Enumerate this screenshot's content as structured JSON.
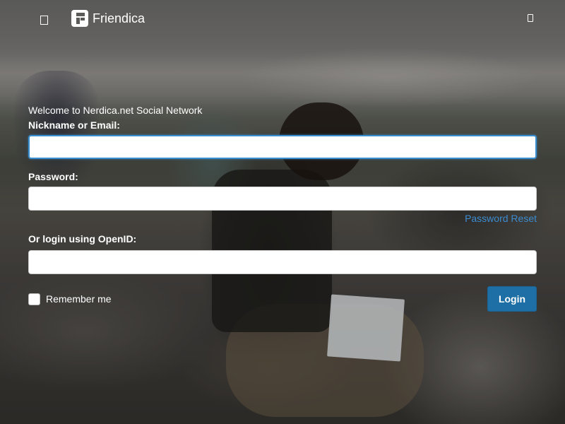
{
  "app": {
    "name": "Friendica"
  },
  "icons": {
    "menu": "menu-toggle-icon",
    "logo": "friendica-logo-icon",
    "account": "login-toggle-icon"
  },
  "colors": {
    "link": "#3b8bd0",
    "button": "#1d6fa5",
    "focus_border": "#3a8fd0"
  },
  "login": {
    "welcome": "Welcome to Nerdica.net Social Network",
    "nickname_label": "Nickname or Email:",
    "nickname_value": "",
    "password_label": "Password:",
    "password_value": "",
    "password_reset": "Password Reset",
    "openid_label": "Or login using OpenID:",
    "openid_value": "",
    "remember_me": "Remember me",
    "remember_checked": false,
    "submit": "Login"
  }
}
